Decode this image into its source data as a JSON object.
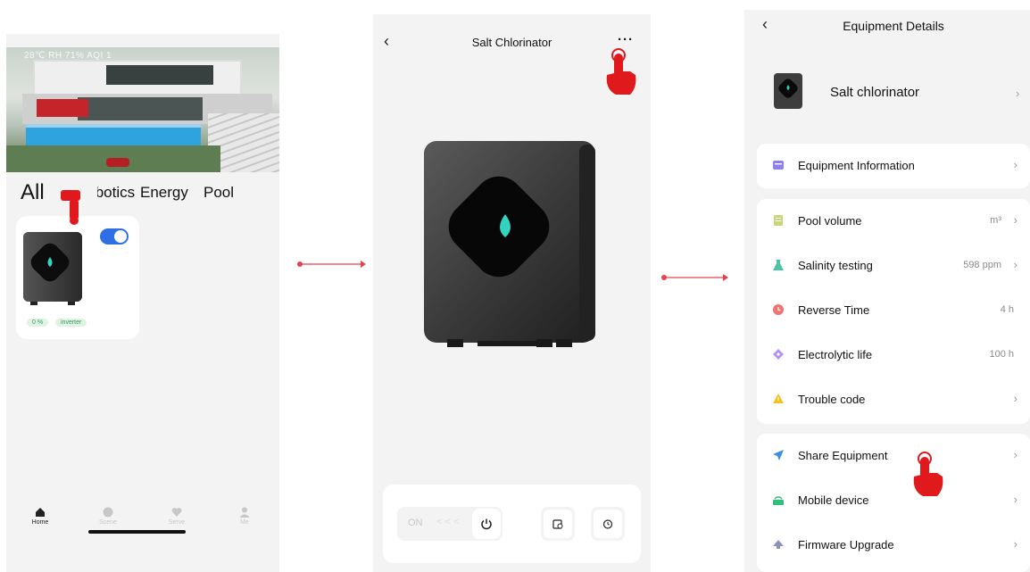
{
  "home": {
    "status_line": "28℃  RH 71%  AQI 1",
    "categories": [
      "All",
      "Robotics",
      "Energy",
      "Pool"
    ],
    "card": {
      "tags": [
        "0 %",
        "inverter"
      ],
      "toggle_on": true
    },
    "tabs": [
      {
        "label": "Home",
        "icon": "home-icon"
      },
      {
        "label": "Scene",
        "icon": "scene-icon"
      },
      {
        "label": "Serve",
        "icon": "heart-icon"
      },
      {
        "label": "Me",
        "icon": "person-icon"
      }
    ]
  },
  "device": {
    "title": "Salt Chlorinator",
    "back_glyph": "‹",
    "more_glyph": "···",
    "switch_label": "ON",
    "switch_chevrons": "< < <"
  },
  "details": {
    "title": "Equipment Details",
    "back_glyph": "‹",
    "device_name": "Salt chlorinator",
    "chevron_glyph": "›",
    "info_row": {
      "label": "Equipment Information",
      "icon": "card-icon",
      "icon_color": "#8f7ff0"
    },
    "settings_rows": [
      {
        "label": "Pool volume",
        "value": "m³",
        "chevron": "›",
        "icon": "list-icon",
        "icon_color": "#c9d87a"
      },
      {
        "label": "Salinity testing",
        "value": "598 ppm",
        "chevron": "›",
        "icon": "flask-icon",
        "icon_color": "#4fc3a5"
      },
      {
        "label": "Reverse Time",
        "value": "4 h",
        "chevron": "",
        "icon": "clock-icon",
        "icon_color": "#f07272"
      },
      {
        "label": "Electrolytic life",
        "value": "100 h",
        "chevron": "",
        "icon": "tag-icon",
        "icon_color": "#b592f0"
      },
      {
        "label": "Trouble code",
        "value": "",
        "chevron": "›",
        "icon": "warning-icon",
        "icon_color": "#f3c11b"
      }
    ],
    "share_rows": [
      {
        "label": "Share Equipment",
        "icon": "send-icon",
        "icon_color": "#3a8ee6"
      },
      {
        "label": "Mobile device",
        "icon": "router-icon",
        "icon_color": "#2fbf7a"
      },
      {
        "label": "Firmware Upgrade",
        "icon": "upload-icon",
        "icon_color": "#8a93b6"
      }
    ]
  },
  "colors": {
    "accent_blue": "#2f6fe6",
    "pointer_red": "#e0191c",
    "arrow_red": "#e5414f",
    "water_cyan": "#34d3c0"
  }
}
